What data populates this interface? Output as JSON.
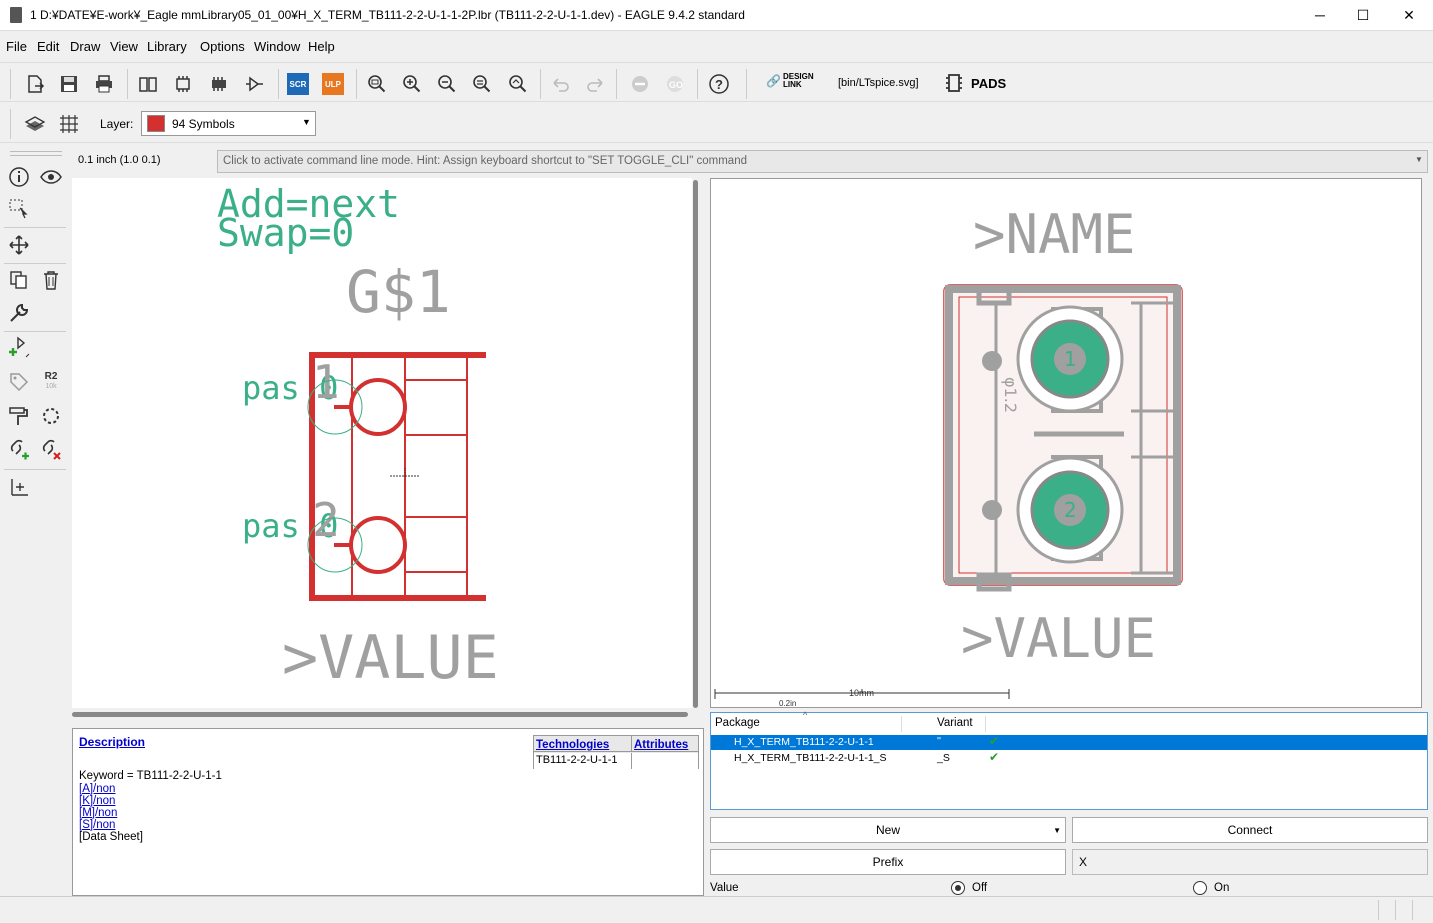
{
  "window": {
    "title": "1 D:¥DATE¥E-work¥_Eagle mmLibrary05_01_00¥H_X_TERM_TB111-2-2-U-1-1-2P.lbr (TB111-2-2-U-1-1.dev) - EAGLE 9.4.2 standard",
    "minimize": "─",
    "maximize": "☐",
    "close": "✕"
  },
  "menu": [
    "File",
    "Edit",
    "Draw",
    "View",
    "Library",
    "Options",
    "Window",
    "Help"
  ],
  "toolbar": {
    "scr_label": "SCR",
    "ulp_label": "ULP",
    "design_link_line1": "DESIGN",
    "design_link_line2": "LINK",
    "ltspice_label": "[bin/LTspice.svg]",
    "pads_label": "PADS",
    "help_glyph": "?"
  },
  "layer": {
    "label": "Layer:",
    "selected": "94 Symbols",
    "color": "#d33030"
  },
  "grid_info": "0.1 inch (1.0 0.1)",
  "command_line": {
    "placeholder": "Click to activate command line mode. Hint: Assign keyboard shortcut to \"SET TOGGLE_CLI\" command"
  },
  "symbol": {
    "add_text": "Add=next",
    "swap_text": "Swap=0",
    "gate_name": "G$1",
    "value_text": ">VALUE",
    "pin1_label": "pas 0",
    "pin1_num": "1",
    "pin2_label": "pas 0",
    "pin2_num": "2"
  },
  "footprint": {
    "name_text": ">NAME",
    "value_text": ">VALUE",
    "dim_text": "φ1.2",
    "pad1": "1",
    "pad2": "2",
    "scale_left": "0.2in",
    "scale_right": "10mm"
  },
  "description": {
    "title": "Description",
    "keyword": "Keyword = TB111-2-2-U-1-1",
    "links": [
      "[A]/non ",
      "[K]/non ",
      "[M]/non ",
      "[S]/non "
    ],
    "datasheet": "[Data Sheet]",
    "technologies_header": "Technologies",
    "attributes_header": "Attributes",
    "technology": "TB111-2-2-U-1-1"
  },
  "packages": {
    "col_package": "Package",
    "col_variant": "Variant",
    "rows": [
      {
        "package": "H_X_TERM_TB111-2-2-U-1-1",
        "variant": "''",
        "selected": true
      },
      {
        "package": "H_X_TERM_TB111-2-2-U-1-1_S",
        "variant": "_S",
        "selected": false
      }
    ]
  },
  "buttons": {
    "new": "New",
    "connect": "Connect",
    "prefix": "Prefix",
    "prefix_value": "X"
  },
  "value_opt": {
    "label": "Value",
    "off": "Off",
    "on": "On",
    "selected": "off"
  },
  "colors": {
    "symbol_red": "#d33030",
    "text_green": "#3aaf88",
    "gray": "#a0a0a0",
    "selection": "#0078d7"
  }
}
